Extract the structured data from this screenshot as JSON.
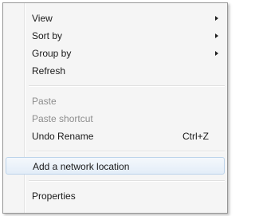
{
  "menu": {
    "items": [
      {
        "label": "View"
      },
      {
        "label": "Sort by"
      },
      {
        "label": "Group by"
      },
      {
        "label": "Refresh"
      },
      {
        "label": "Paste"
      },
      {
        "label": "Paste shortcut"
      },
      {
        "label": "Undo Rename",
        "shortcut": "Ctrl+Z"
      },
      {
        "label": "Add a network location"
      },
      {
        "label": "Properties"
      }
    ]
  }
}
